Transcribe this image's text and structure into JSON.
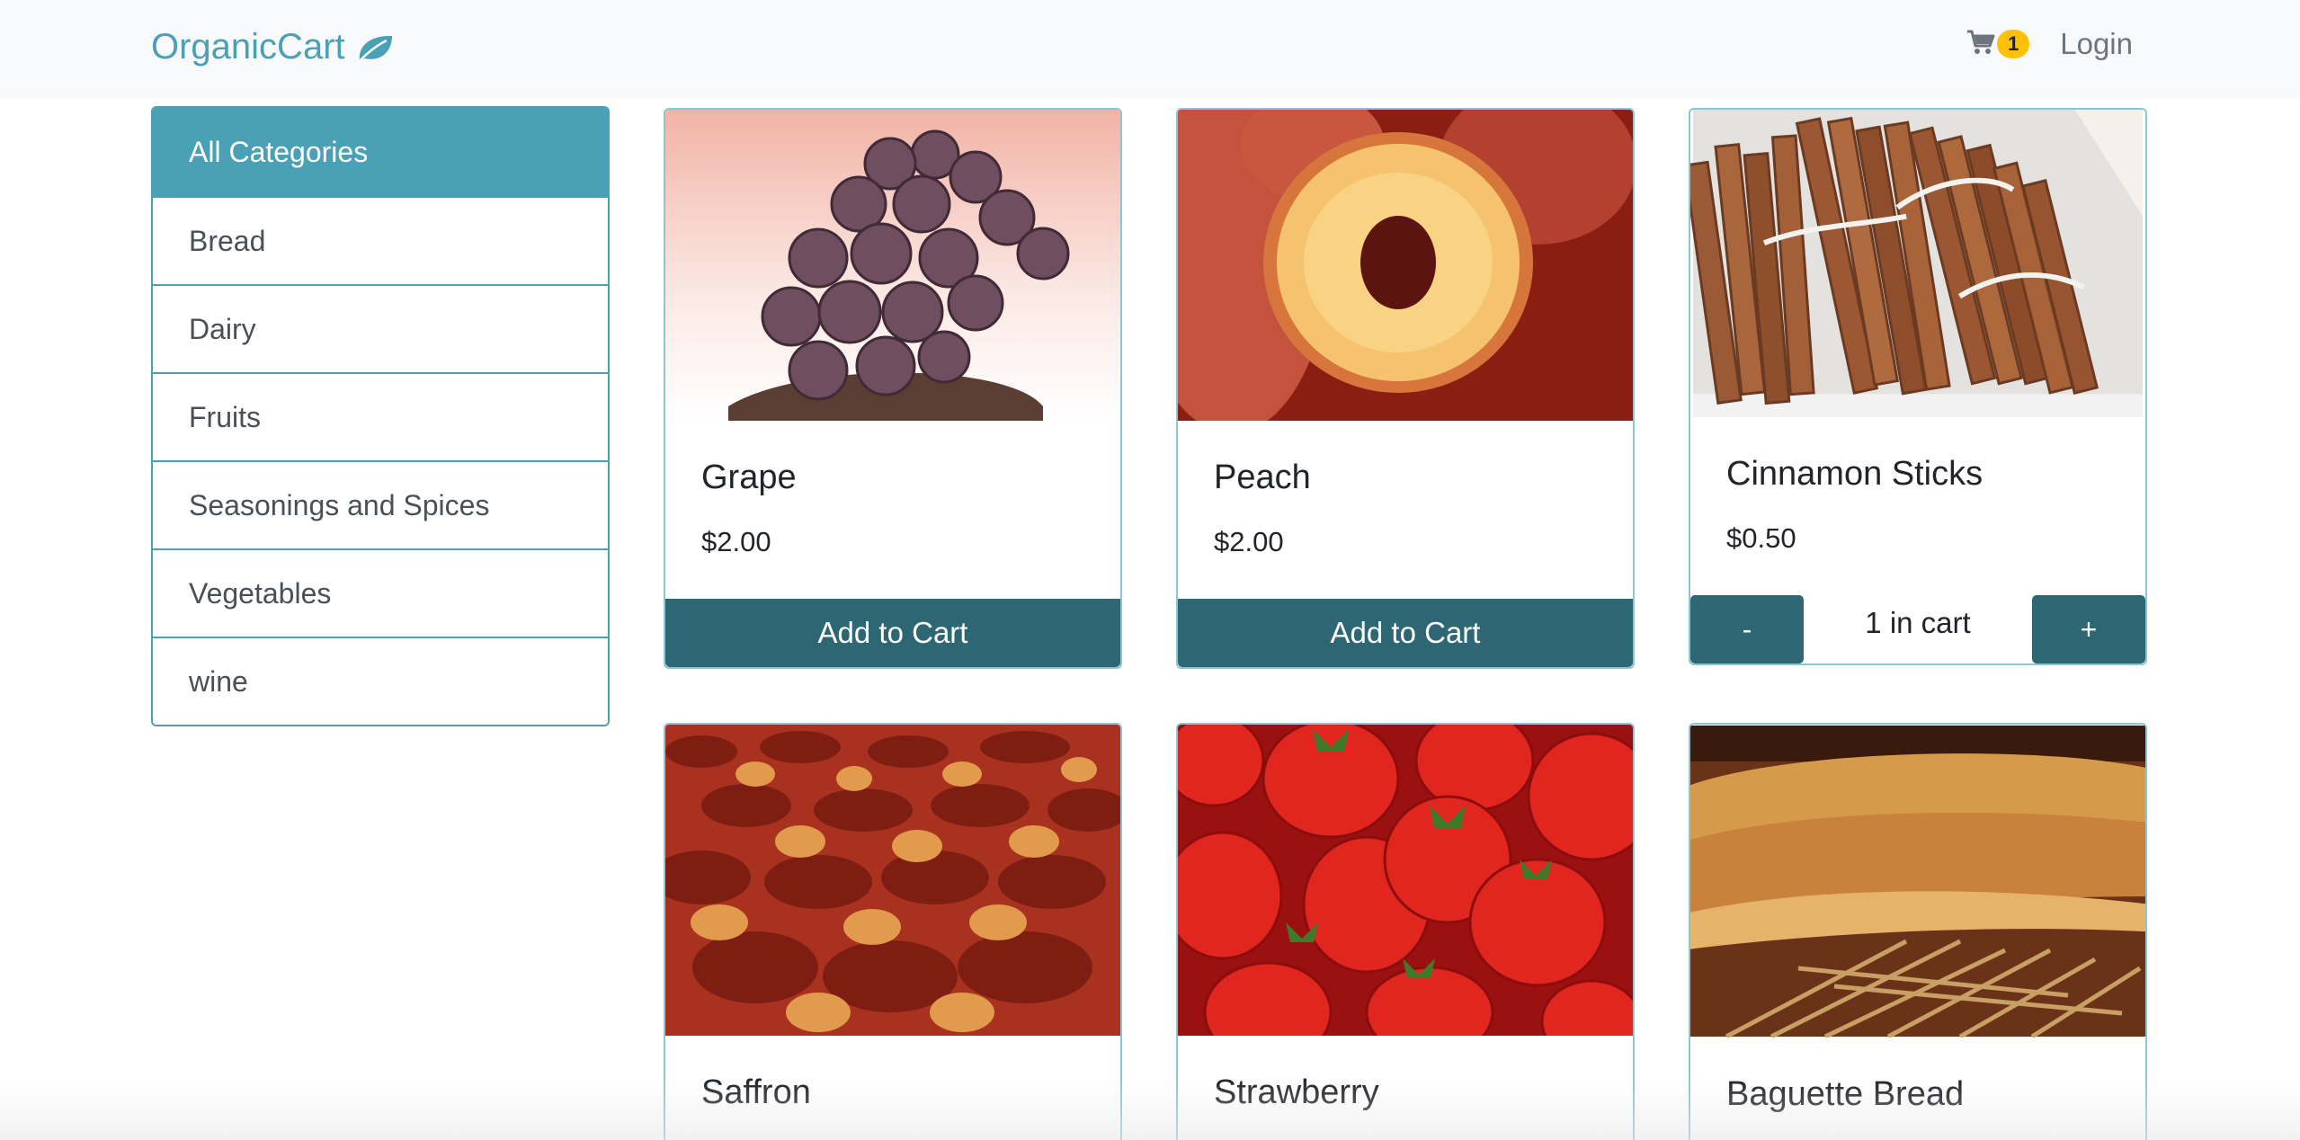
{
  "navbar": {
    "brand": "OrganicCart",
    "brand_icon": "leaf-icon",
    "cart_icon": "shopping-cart-icon",
    "cart_count": "1",
    "login_label": "Login",
    "brand_color": "#4aa0b5"
  },
  "sidebar": {
    "items": [
      {
        "label": "All Categories"
      },
      {
        "label": "Bread"
      },
      {
        "label": "Dairy"
      },
      {
        "label": "Fruits"
      },
      {
        "label": "Seasonings and Spices"
      },
      {
        "label": "Vegetables"
      },
      {
        "label": "wine"
      }
    ],
    "active_index": 0
  },
  "products": [
    {
      "name": "Grape",
      "price": "$2.00",
      "action": "Add to Cart"
    },
    {
      "name": "Peach",
      "price": "$2.00",
      "action": "Add to Cart"
    },
    {
      "name": "Cinnamon Sticks",
      "price": "$0.50",
      "decrement": "-",
      "qty_text": "1 in cart",
      "increment": "+"
    },
    {
      "name": "Saffron"
    },
    {
      "name": "Strawberry"
    },
    {
      "name": "Baguette Bread"
    }
  ],
  "colors": {
    "accent": "#4aa0b5",
    "button": "#2c6773",
    "badge": "#ffc107"
  }
}
